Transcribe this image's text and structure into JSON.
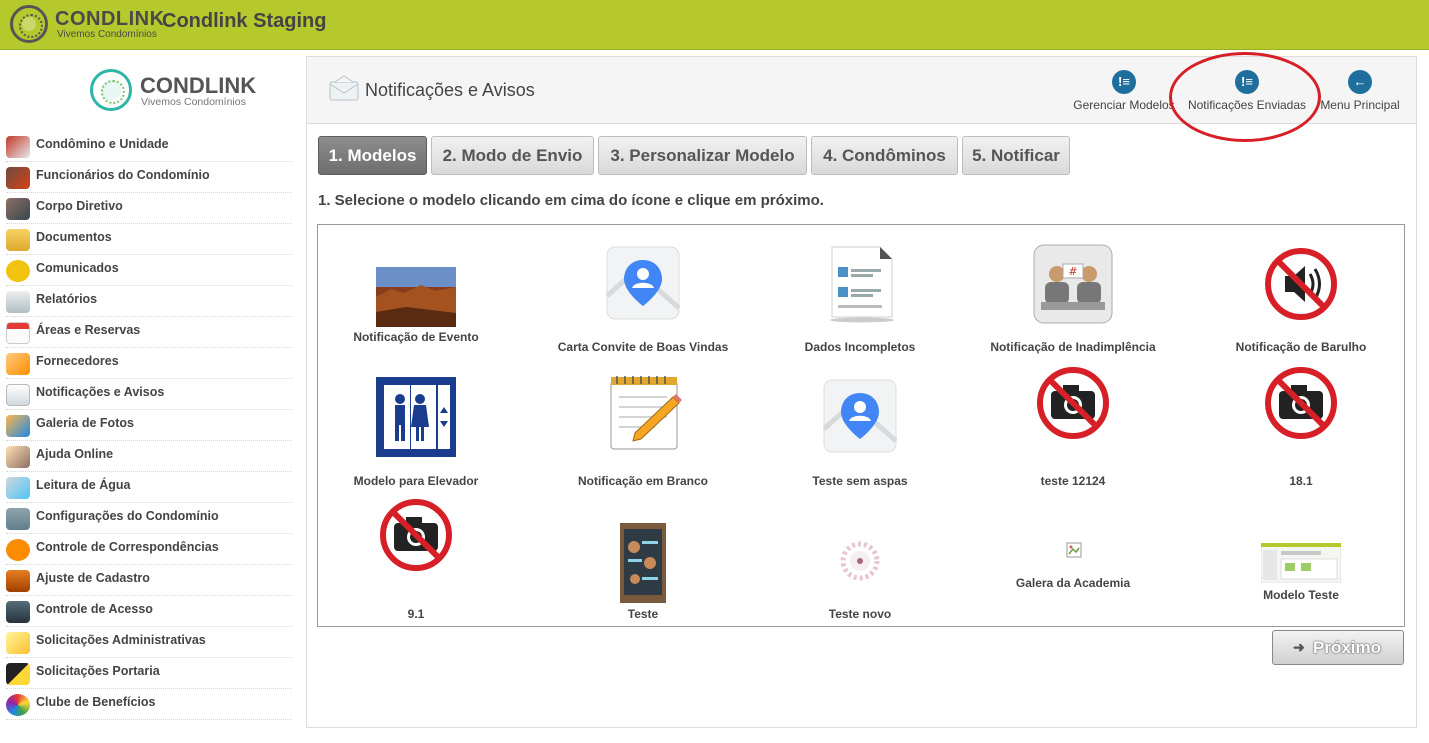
{
  "topbar": {
    "brand": "CONDLINK",
    "brand_sub": "Vivemos Condomínios",
    "app_title": "Condlink Staging"
  },
  "sidebar": {
    "brand": "CONDLINK",
    "brand_sub": "Vivemos Condomínios",
    "items": [
      {
        "label": "Condômino e Unidade",
        "icon": "person-house-icon"
      },
      {
        "label": "Funcionários do Condomínio",
        "icon": "employees-icon"
      },
      {
        "label": "Corpo Diretivo",
        "icon": "director-icon"
      },
      {
        "label": "Documentos",
        "icon": "folder-icon"
      },
      {
        "label": "Comunicados",
        "icon": "warning-icon"
      },
      {
        "label": "Relatórios",
        "icon": "report-icon"
      },
      {
        "label": "Áreas e Reservas",
        "icon": "calendar-icon"
      },
      {
        "label": "Fornecedores",
        "icon": "handshake-icon"
      },
      {
        "label": "Notificações e Avisos",
        "icon": "envelope-icon"
      },
      {
        "label": "Galeria de Fotos",
        "icon": "photos-icon"
      },
      {
        "label": "Ajuda Online",
        "icon": "help-people-icon"
      },
      {
        "label": "Leitura de Água",
        "icon": "faucet-icon"
      },
      {
        "label": "Configurações do Condomínio",
        "icon": "buildings-icon"
      },
      {
        "label": "Controle de Correspondências",
        "icon": "mail-icon"
      },
      {
        "label": "Ajuste de Cadastro",
        "icon": "briefcase-icon"
      },
      {
        "label": "Controle de Acesso",
        "icon": "camera-icon"
      },
      {
        "label": "Solicitações Administrativas",
        "icon": "note-icon"
      },
      {
        "label": "Solicitações Portaria",
        "icon": "barrier-icon"
      },
      {
        "label": "Clube de Benefícios",
        "icon": "colorful-ball-icon"
      }
    ]
  },
  "panel": {
    "title": "Notificações e Avisos",
    "actions": [
      {
        "label": "Gerenciar Modelos",
        "icon": "alert-list-icon"
      },
      {
        "label": "Notificações Enviadas",
        "icon": "alert-list-icon"
      },
      {
        "label": "Menu Principal",
        "icon": "back-arrow-icon"
      }
    ]
  },
  "tabs": [
    "1. Modelos",
    "2. Modo de Envio",
    "3. Personalizar Modelo",
    "4. Condôminos",
    "5. Notificar"
  ],
  "active_tab": "1. Modelos",
  "instructions": "1. Selecione o modelo clicando em cima do ícone e clique em próximo.",
  "models": [
    {
      "label": "Notificação de Evento",
      "image": "desert-landscape-photo"
    },
    {
      "label": "Carta Convite de Boas Vindas",
      "image": "map-person-icon"
    },
    {
      "label": "Dados Incompletos",
      "image": "document-form-icon"
    },
    {
      "label": "Notificação de Inadimplência",
      "image": "debt-meeting-icon"
    },
    {
      "label": "Notificação de Barulho",
      "image": "no-noise-icon"
    },
    {
      "label": "Modelo para Elevador",
      "image": "elevator-icon"
    },
    {
      "label": "Notificação em Branco",
      "image": "notepad-pencil-icon"
    },
    {
      "label": "Teste sem aspas",
      "image": "map-person-icon"
    },
    {
      "label": "teste 12124",
      "image": "no-camera-icon"
    },
    {
      "label": "18.1",
      "image": "no-camera-icon"
    },
    {
      "label": "9.1",
      "image": "no-camera-icon"
    },
    {
      "label": "Teste",
      "image": "poster-photo"
    },
    {
      "label": "Teste novo",
      "image": "floral-logo-image"
    },
    {
      "label": "Galera da Academia",
      "image": "broken-image-icon"
    },
    {
      "label": "Modelo Teste",
      "image": "screenshot-thumbnail"
    }
  ],
  "next_button": "Próximo"
}
